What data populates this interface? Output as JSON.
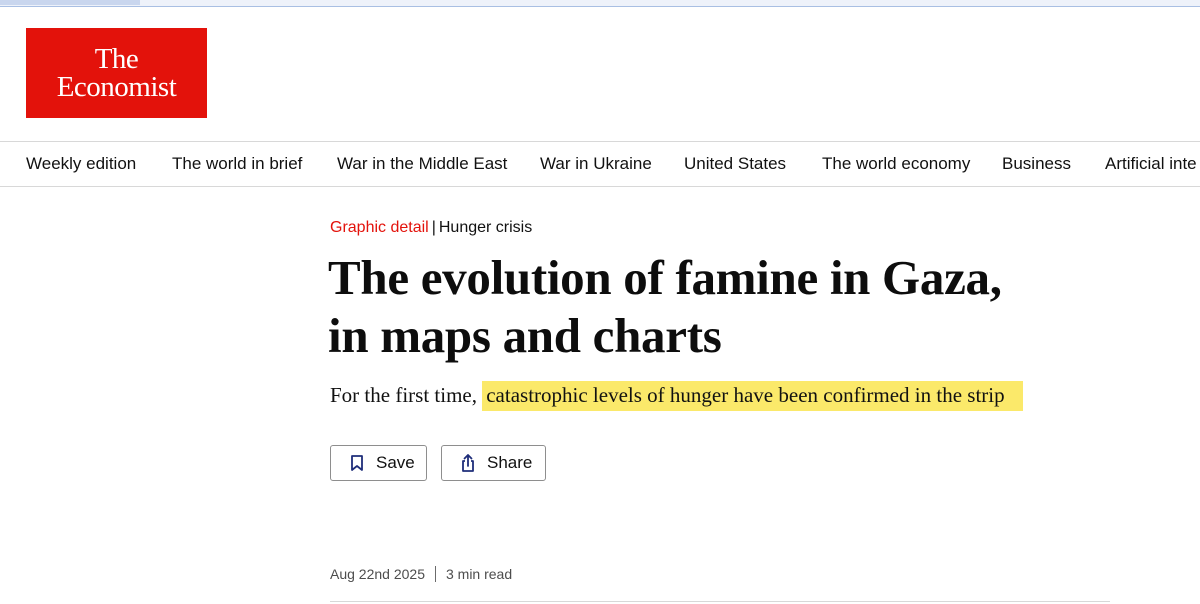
{
  "logo": {
    "line1": "The",
    "line2": "Economist"
  },
  "nav": {
    "items": [
      "Weekly edition",
      "The world in brief",
      "War in the Middle East",
      "War in Ukraine",
      "United States",
      "The world economy",
      "Business",
      "Artificial inte"
    ]
  },
  "article": {
    "section": "Graphic detail",
    "separator": "|",
    "topic": "Hunger crisis",
    "headline_line1": "The evolution of famine in Gaza,",
    "headline_line2": "in maps and charts",
    "standfirst_lead": "For the first time,",
    "standfirst_highlight": "catastrophic levels of hunger have been confirmed in the strip",
    "date": "Aug 22nd 2025",
    "read_time": "3 min read"
  },
  "actions": {
    "save_label": "Save",
    "share_label": "Share"
  },
  "colors": {
    "brand_red": "#e3120b",
    "highlight": "#fbe96a",
    "icon_blue": "#1f2e7a"
  }
}
